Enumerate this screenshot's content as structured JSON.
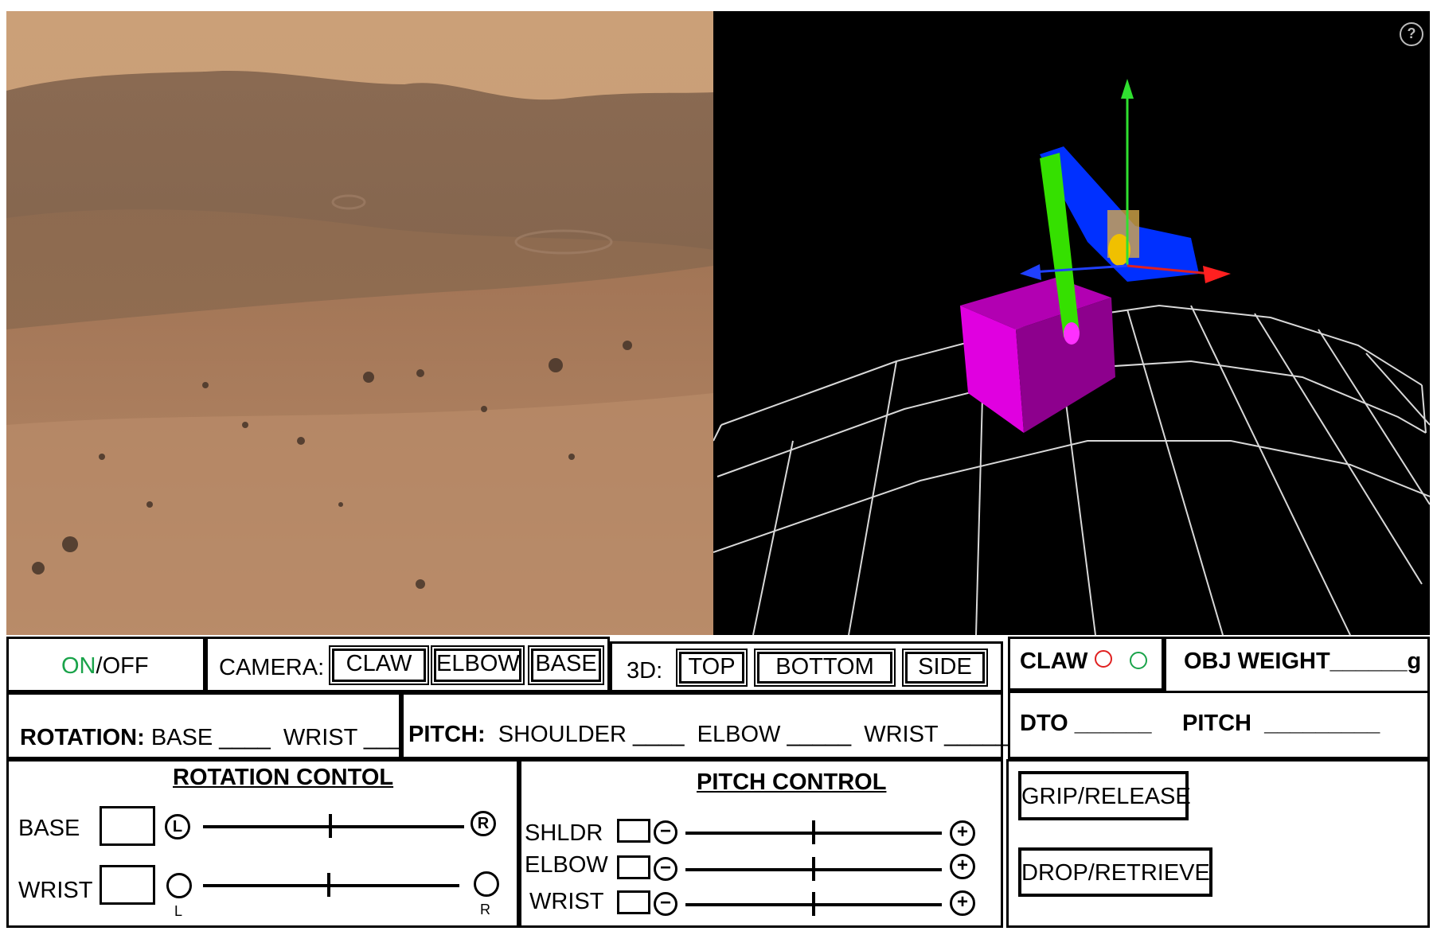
{
  "help_icon": "?",
  "status": {
    "on": "ON",
    "sep": "/",
    "off": "OFF",
    "on_color": "#1aa34a"
  },
  "camera": {
    "label": "CAMERA:",
    "buttons": [
      "CLAW",
      "ELBOW",
      "BASE"
    ]
  },
  "view3d": {
    "label": "3D:",
    "buttons": [
      "TOP",
      "BOTTOM",
      "SIDE"
    ]
  },
  "claw_status": {
    "label": "CLAW",
    "red": "#e02020",
    "green": "#1aa34a"
  },
  "obj_weight": {
    "label": "OBJ WEIGHT",
    "blank": "______",
    "unit": "g"
  },
  "rotation_readout": {
    "label": "ROTATION:",
    "base": "BASE ____",
    "wrist": "WRIST ____"
  },
  "pitch_readout": {
    "label": "PITCH:",
    "shoulder": "SHOULDER ____",
    "elbow": "ELBOW _____",
    "wrist": "WRIST _____"
  },
  "dto": {
    "label": "DTO",
    "blank": "______"
  },
  "pitch_right": {
    "label": "PITCH",
    "blank": "_________"
  },
  "rotation_control": {
    "title": "ROTATION CONTOL",
    "base": {
      "label": "BASE",
      "left": "L",
      "right": "R"
    },
    "wrist": {
      "label": "WRIST",
      "left": "L",
      "right": "R"
    }
  },
  "pitch_control": {
    "title": "PITCH CONTROL",
    "rows": [
      {
        "label": "SHLDR",
        "minus": "−",
        "plus": "+"
      },
      {
        "label": "ELBOW",
        "minus": "−",
        "plus": "+"
      },
      {
        "label": "WRIST",
        "minus": "−",
        "plus": "+"
      }
    ]
  },
  "actions": {
    "grip": "GRIP/RELEASE",
    "drop": "DROP/RETRIEVE"
  },
  "icons": [
    "help-icon",
    "claw-status-red-icon",
    "claw-status-green-icon"
  ]
}
